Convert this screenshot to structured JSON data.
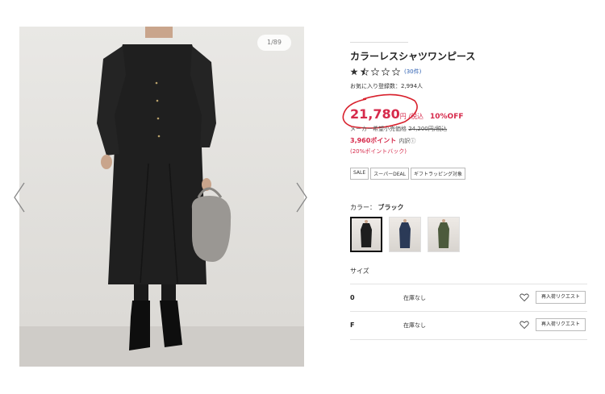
{
  "gallery": {
    "counter": "1/89",
    "prev_icon": "chevron-left-icon",
    "next_icon": "chevron-right-icon"
  },
  "product": {
    "title": "カラーレスシャツワンピース",
    "rating": 1.5,
    "review_count": "(30件)",
    "favorites": "お気に入り登録数：2,994人",
    "price": "21,780",
    "price_unit": "円 /税込",
    "discount": "10%OFF",
    "original_price_label": "メーカー希望小売価格",
    "original_price": "24,200円/税込",
    "points": "3,960ポイント",
    "points_detail": "内訳",
    "points_back": "(20%ポイントバック)",
    "tags": [
      "SALE",
      "スーパーDEAL",
      "ギフトラッピング対象"
    ]
  },
  "colors": {
    "label": "カラー：",
    "selected": "ブラック",
    "swatches": [
      {
        "name": "black",
        "hex": "#1e1e1e"
      },
      {
        "name": "navy",
        "hex": "#2b3a57"
      },
      {
        "name": "khaki",
        "hex": "#4c5a3c"
      }
    ]
  },
  "sizes": {
    "label": "サイズ",
    "rows": [
      {
        "size": "0",
        "stock": "在庫なし",
        "button": "再入荷リクエスト"
      },
      {
        "size": "F",
        "stock": "在庫なし",
        "button": "再入荷リクエスト"
      }
    ]
  },
  "theme": {
    "accent": "#d62a4b",
    "link": "#2a5db0"
  }
}
